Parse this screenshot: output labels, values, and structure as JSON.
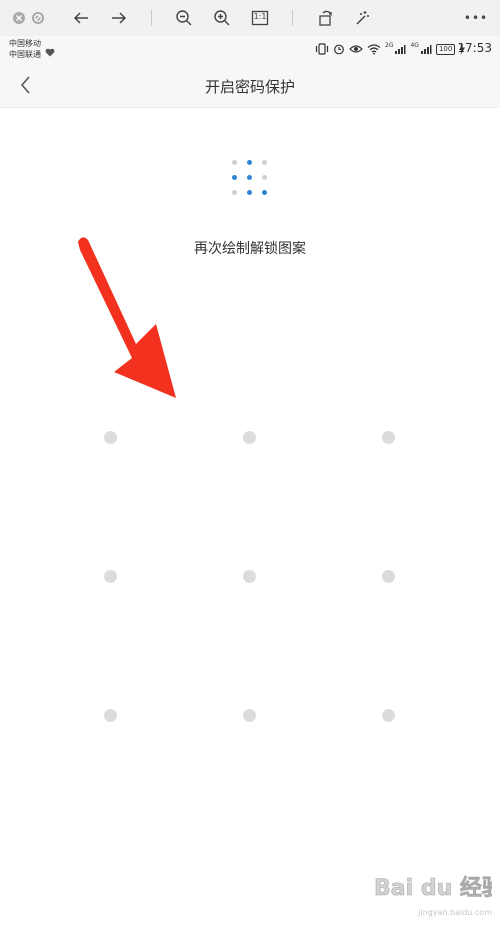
{
  "viewer_toolbar": {
    "icons": [
      "close-circle-icon",
      "block-icon",
      "arrow-left-icon",
      "arrow-right-icon",
      "zoom-out-icon",
      "zoom-in-icon",
      "actual-size-icon",
      "rotate-icon",
      "magic-wand-icon",
      "more-icon"
    ],
    "actual_size_label": "1:1",
    "more_label": "•••"
  },
  "status_bar": {
    "carrier_1": "中国移动",
    "carrier_2": "中国联通",
    "net_1": "2G",
    "net_2": "4G",
    "battery": "100",
    "time": "17:53"
  },
  "header": {
    "title": "开启密码保护"
  },
  "pattern_preview": {
    "active_color": "#2f84d6",
    "inactive_color": "#cfcfcf",
    "dots_active": [
      false,
      true,
      false,
      true,
      true,
      false,
      false,
      true,
      true
    ]
  },
  "hint": "再次绘制解锁图案",
  "pattern_grid": {
    "node_color": "#dcdcdc",
    "rows": 3,
    "cols": 3
  },
  "annotation": {
    "arrow_color": "#f2311e"
  },
  "watermark": {
    "text": "Bai du 经验",
    "sub": "jingyan.baidu.com"
  }
}
